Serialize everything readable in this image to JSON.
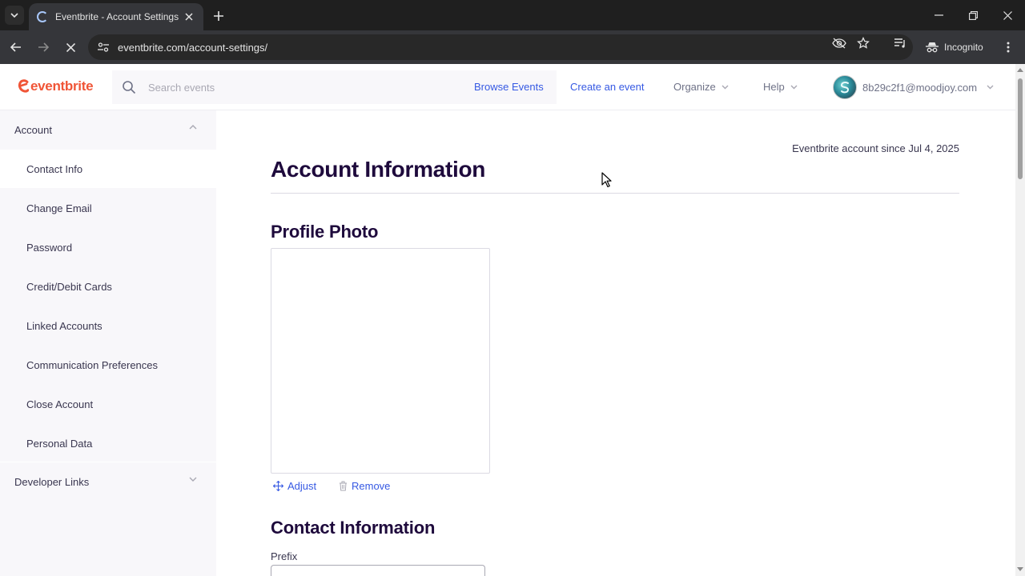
{
  "browser": {
    "tab_title": "Eventbrite - Account Settings",
    "url": "eventbrite.com/account-settings/",
    "incognito_label": "Incognito"
  },
  "header": {
    "logo_text": "eventbrite",
    "search_placeholder": "Search events",
    "nav": {
      "browse": "Browse Events",
      "create": "Create an event",
      "organize": "Organize",
      "help": "Help"
    },
    "user_email": "8b29c2f1@moodjoy.com"
  },
  "sidebar": {
    "account_label": "Account",
    "items": [
      {
        "label": "Contact Info"
      },
      {
        "label": "Change Email"
      },
      {
        "label": "Password"
      },
      {
        "label": "Credit/Debit Cards"
      },
      {
        "label": "Linked Accounts"
      },
      {
        "label": "Communication Preferences"
      },
      {
        "label": "Close Account"
      },
      {
        "label": "Personal Data"
      }
    ],
    "developer_label": "Developer Links"
  },
  "main": {
    "account_since": "Eventbrite account since Jul 4, 2025",
    "title": "Account Information",
    "profile_photo_heading": "Profile Photo",
    "adjust_label": "Adjust",
    "remove_label": "Remove",
    "contact_heading": "Contact Information",
    "prefix_label": "Prefix"
  },
  "colors": {
    "brand": "#f05537",
    "link": "#3659e3",
    "heading": "#1e0a3c",
    "sidebar_bg": "#f8f7fa"
  }
}
